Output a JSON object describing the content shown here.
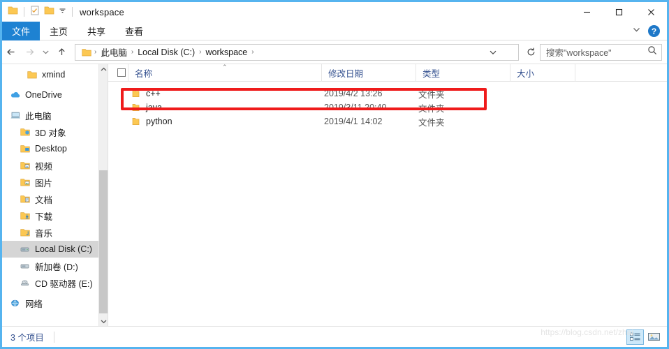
{
  "window": {
    "title": "workspace",
    "accent_color": "#56b4ef",
    "quick_access": [
      {
        "name": "folder-icon",
        "label": "folder"
      },
      {
        "name": "properties-icon",
        "label": "properties"
      },
      {
        "name": "new-folder-icon",
        "label": "new folder"
      },
      {
        "name": "customize-chevron-icon",
        "label": "customize"
      }
    ],
    "controls": {
      "minimize": "minimize",
      "maximize": "maximize",
      "close": "close"
    }
  },
  "ribbon": {
    "tabs": [
      {
        "label": "文件",
        "active": true
      },
      {
        "label": "主页",
        "active": false
      },
      {
        "label": "共享",
        "active": false
      },
      {
        "label": "查看",
        "active": false
      }
    ],
    "expand_label": "展开功能区",
    "help_label": "?"
  },
  "address": {
    "back": "←",
    "forward": "→",
    "recent": "⌄",
    "up": "↑",
    "breadcrumbs": [
      "此电脑",
      "Local Disk (C:)",
      "workspace"
    ],
    "separator": "›",
    "dropdown": "⌄",
    "refresh": "↻"
  },
  "search": {
    "placeholder": "搜索\"workspace\"",
    "icon": "search-icon"
  },
  "sidebar": {
    "items": [
      {
        "label": "xmind",
        "icon": "folder-icon",
        "level": 2,
        "selected": false
      },
      {
        "label": "OneDrive",
        "icon": "cloud-icon",
        "level": 0,
        "selected": false
      },
      {
        "label": "此电脑",
        "icon": "computer-icon",
        "level": 0,
        "selected": false
      },
      {
        "label": "3D 对象",
        "icon": "folder-3d-icon",
        "level": 1,
        "selected": false
      },
      {
        "label": "Desktop",
        "icon": "folder-desktop-icon",
        "level": 1,
        "selected": false
      },
      {
        "label": "视频",
        "icon": "folder-video-icon",
        "level": 1,
        "selected": false
      },
      {
        "label": "图片",
        "icon": "folder-pictures-icon",
        "level": 1,
        "selected": false
      },
      {
        "label": "文档",
        "icon": "folder-documents-icon",
        "level": 1,
        "selected": false
      },
      {
        "label": "下载",
        "icon": "folder-downloads-icon",
        "level": 1,
        "selected": false
      },
      {
        "label": "音乐",
        "icon": "folder-music-icon",
        "level": 1,
        "selected": false
      },
      {
        "label": "Local Disk (C:)",
        "icon": "drive-icon",
        "level": 1,
        "selected": true
      },
      {
        "label": "新加卷 (D:)",
        "icon": "drive-icon",
        "level": 1,
        "selected": false
      },
      {
        "label": "CD 驱动器 (E:)",
        "icon": "cd-drive-icon",
        "level": 1,
        "selected": false
      },
      {
        "label": "网络",
        "icon": "network-icon",
        "level": 0,
        "selected": false
      }
    ]
  },
  "filelist": {
    "columns": [
      {
        "label": "名称",
        "sorted": true,
        "sort_caret": "⌃"
      },
      {
        "label": "修改日期",
        "sorted": false
      },
      {
        "label": "类型",
        "sorted": false
      },
      {
        "label": "大小",
        "sorted": false
      }
    ],
    "rows": [
      {
        "name": "c++",
        "date": "2019/4/2 13:26",
        "type": "文件夹",
        "size": "",
        "icon": "folder-icon",
        "highlighted": true
      },
      {
        "name": "java",
        "date": "2019/3/11 20:40",
        "type": "文件夹",
        "size": "",
        "icon": "folder-icon",
        "highlighted": false
      },
      {
        "name": "python",
        "date": "2019/4/1 14:02",
        "type": "文件夹",
        "size": "",
        "icon": "folder-icon",
        "highlighted": false
      }
    ]
  },
  "annotation": {
    "color": "#ef1b1b",
    "target": "c++"
  },
  "statusbar": {
    "item_count": "3 个项目",
    "views": [
      {
        "name": "details-view",
        "active": true
      },
      {
        "name": "large-icons-view",
        "active": false
      }
    ]
  },
  "watermark": {
    "text": "https://blog.csdn.net/zhai"
  }
}
